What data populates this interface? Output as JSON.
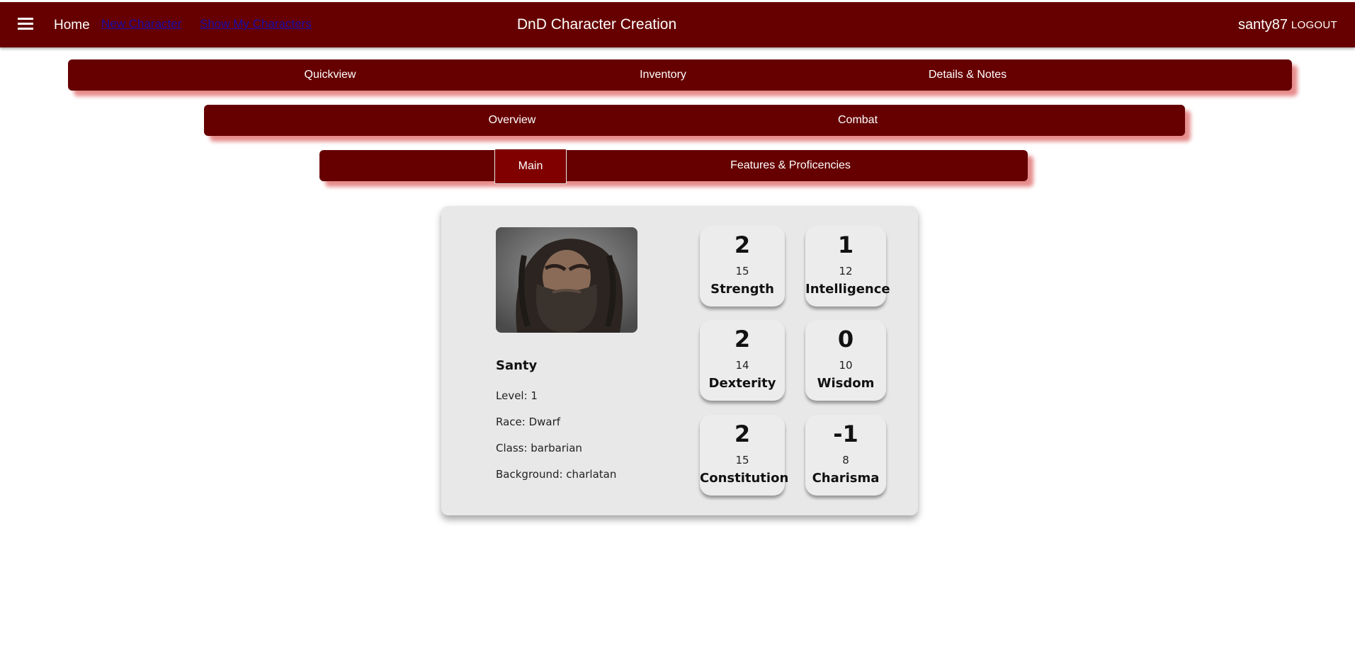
{
  "header": {
    "title": "DnD Character Creation",
    "home_label": "Home",
    "new_character_label": "New Character",
    "show_characters_label": "Show My Characters",
    "username": "santy87",
    "logout_label": "LOGOUT"
  },
  "tabs_primary": [
    "Quickview",
    "Inventory",
    "Details & Notes"
  ],
  "tabs_secondary": [
    "Overview",
    "Combat"
  ],
  "tabs_tertiary": {
    "main": "Main",
    "features": "Features & Proficencies"
  },
  "character": {
    "name": "Santy",
    "level": "Level: 1",
    "race": "Race: Dwarf",
    "class": "Class: barbarian",
    "background": "Background: charlatan"
  },
  "stats": [
    {
      "modifier": "2",
      "score": "15",
      "label": "Strength"
    },
    {
      "modifier": "1",
      "score": "12",
      "label": "Intelligence"
    },
    {
      "modifier": "2",
      "score": "14",
      "label": "Dexterity"
    },
    {
      "modifier": "0",
      "score": "10",
      "label": "Wisdom"
    },
    {
      "modifier": "2",
      "score": "15",
      "label": "Constitution"
    },
    {
      "modifier": "-1",
      "score": "8",
      "label": "Charisma"
    }
  ],
  "colors": {
    "brand": "#660000",
    "active_tab": "#800000",
    "card_bg": "#e8e8e8"
  },
  "icons": {
    "menu": "hamburger-menu-icon"
  }
}
